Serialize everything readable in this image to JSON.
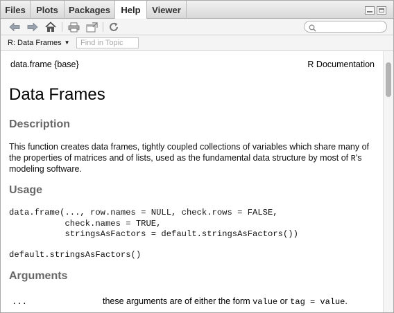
{
  "tabs": [
    {
      "label": "Files"
    },
    {
      "label": "Plots"
    },
    {
      "label": "Packages"
    },
    {
      "label": "Help",
      "active": true
    },
    {
      "label": "Viewer"
    }
  ],
  "toolbar": {
    "icons": [
      "back-arrow-icon",
      "forward-arrow-icon",
      "home-icon",
      "print-icon",
      "open-in-window-icon",
      "refresh-icon"
    ],
    "search_placeholder": ""
  },
  "topic_bar": {
    "selected_topic": "R: Data Frames",
    "find_placeholder": "Find in Topic"
  },
  "document": {
    "package_ref": "data.frame {base}",
    "rdoc_label": "R Documentation",
    "title": "Data Frames",
    "description_heading": "Description",
    "description_text_pre": "This function creates data frames, tightly coupled collections of variables which share many of the properties of matrices and of lists, used as the fundamental data structure by most of ",
    "description_r": "R",
    "description_text_post": "'s modeling software.",
    "usage_heading": "Usage",
    "usage_code_1": "data.frame(..., row.names = NULL, check.rows = FALSE,\n           check.names = TRUE,\n           stringsAsFactors = default.stringsAsFactors())",
    "usage_code_2": "default.stringsAsFactors()",
    "arguments_heading": "Arguments",
    "arguments": [
      {
        "name": "...",
        "desc_pre": "these arguments are of either the form ",
        "desc_code_1": "value",
        "desc_mid": " or ",
        "desc_code_2": "tag = value",
        "desc_post": "."
      }
    ]
  },
  "colors": {
    "section_heading": "#666666",
    "tab_bar": "#e2e2e2",
    "active_tab": "#ffffff",
    "scroll_thumb": "#b3b3b3"
  }
}
